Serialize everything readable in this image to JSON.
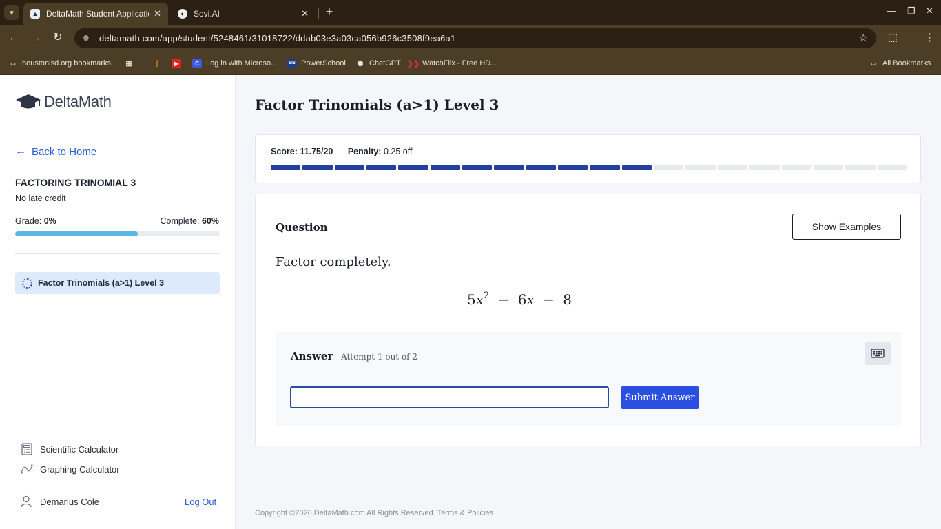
{
  "browser": {
    "tabs": [
      {
        "title": "DeltaMath Student Application",
        "active": true,
        "favicon": "graduation-cap-icon"
      },
      {
        "title": "Sovi.AI",
        "active": false,
        "favicon": "sovi-icon"
      }
    ],
    "url": "deltamath.com/app/student/5248461/31018722/ddab03e3a03ca056b926c3508f9ea6a1",
    "bookmarks": [
      {
        "label": "houstonisd.org bookmarks",
        "icon": "folder-icon"
      },
      {
        "label": "",
        "icon": "apps-grid-icon"
      },
      {
        "label": "",
        "icon": "flame-icon"
      },
      {
        "label": "",
        "icon": "youtube-icon"
      },
      {
        "label": "Log in with Microso...",
        "icon": "c-logo-icon"
      },
      {
        "label": "PowerSchool",
        "icon": "sis-icon"
      },
      {
        "label": "ChatGPT",
        "icon": "chatgpt-icon"
      },
      {
        "label": "WatchFlix - Free HD...",
        "icon": "watchflix-icon"
      }
    ],
    "all_bookmarks": "All Bookmarks",
    "sis_badge": "SIS"
  },
  "sidebar": {
    "logo": "DeltaMath",
    "back_home": "Back to Home",
    "assignment_title": "FACTORING TRINOMIAL 3",
    "late_credit": "No late credit",
    "grade_label": "Grade:",
    "grade_value": "0%",
    "complete_label": "Complete:",
    "complete_value": "60%",
    "complete_fraction": 0.6,
    "tasks": [
      {
        "label": "Factor Trinomials (a>1) Level 3"
      }
    ],
    "tools": [
      {
        "label": "Scientific Calculator",
        "icon": "calculator-icon"
      },
      {
        "label": "Graphing Calculator",
        "icon": "graph-icon"
      }
    ],
    "user_name": "Demarius Cole",
    "logout": "Log Out"
  },
  "main": {
    "title": "Factor Trinomials (a>1) Level 3",
    "score_label": "Score:",
    "score_value": "11.75/20",
    "penalty_label": "Penalty:",
    "penalty_value": "0.25 off",
    "progress_segments_total": 20,
    "progress_segments_done": 12,
    "accent_color": "#25409c",
    "question_label": "Question",
    "show_examples": "Show Examples",
    "prompt": "Factor completely.",
    "expression": {
      "coef1": "5",
      "var": "x",
      "exp": "2",
      "op1": "−",
      "coef2": "6",
      "op2": "−",
      "const": "8"
    },
    "answer_label": "Answer",
    "attempt": "Attempt 1 out of 2",
    "answer_value": "",
    "submit": "Submit Answer",
    "submit_color": "#2b4fe0"
  },
  "footer": {
    "copyright": "Copyright ©2026 DeltaMath.com All Rights Reserved.",
    "terms": "Terms & Policies"
  }
}
